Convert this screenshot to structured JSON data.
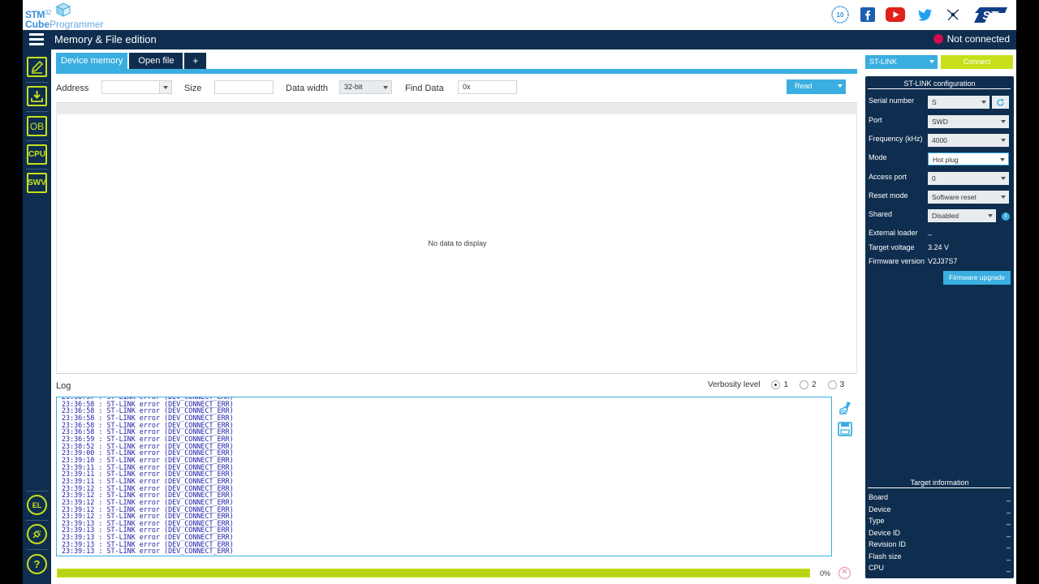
{
  "app": {
    "logo_line1": "STM",
    "logo_line1_sup": "32",
    "logo_line2a": "Cube",
    "logo_line2b": "Programmer"
  },
  "header": {
    "social_icons": [
      "anniversary-badge-icon",
      "facebook-icon",
      "youtube-icon",
      "twitter-icon",
      "network-icon",
      "st-logo-icon"
    ],
    "anniversary_text": "10"
  },
  "titlebar": {
    "title": "Memory & File edition",
    "status": "Not connected",
    "status_color": "#d10b4f"
  },
  "sidebar": {
    "items": [
      {
        "icon": "pencil-edit-icon"
      },
      {
        "icon": "download-icon"
      },
      {
        "icon": "ob-icon",
        "label": "OB"
      },
      {
        "icon": "cpu-icon",
        "label": "CPU"
      },
      {
        "icon": "swv-icon",
        "label": "SWV"
      }
    ],
    "bottom_items": [
      {
        "icon": "el-icon",
        "label": "EL"
      },
      {
        "icon": "plug-icon"
      },
      {
        "icon": "help-icon",
        "label": "?"
      }
    ]
  },
  "tabs": [
    {
      "label": "Device memory",
      "active": true
    },
    {
      "label": "Open file",
      "active": false
    },
    {
      "label": "+",
      "active": false
    }
  ],
  "toolbar": {
    "address_label": "Address",
    "address_value": "",
    "size_label": "Size",
    "size_value": "",
    "data_width_label": "Data width",
    "data_width_value": "32-bit",
    "find_label": "Find Data",
    "find_value": "0x",
    "read_label": "Read"
  },
  "memory": {
    "empty_text": "No data to display"
  },
  "log": {
    "label": "Log",
    "verbosity_label": "Verbosity level",
    "levels": [
      "1",
      "2",
      "3"
    ],
    "selected_level": "1",
    "lines": [
      "23:36:57 : ST-LINK error (DEV_CONNECT_ERR)",
      "23:36:58 : ST-LINK error (DEV_CONNECT_ERR)",
      "23:36:58 : ST-LINK error (DEV_CONNECT_ERR)",
      "23:36:58 : ST-LINK error (DEV_CONNECT_ERR)",
      "23:36:58 : ST-LINK error (DEV_CONNECT_ERR)",
      "23:36:58 : ST-LINK error (DEV_CONNECT_ERR)",
      "23:36:59 : ST-LINK error (DEV_CONNECT_ERR)",
      "23:38:52 : ST-LINK error (DEV_CONNECT_ERR)",
      "23:39:00 : ST-LINK error (DEV_CONNECT_ERR)",
      "23:39:10 : ST-LINK error (DEV_CONNECT_ERR)",
      "23:39:11 : ST-LINK error (DEV_CONNECT_ERR)",
      "23:39:11 : ST-LINK error (DEV_CONNECT_ERR)",
      "23:39:11 : ST-LINK error (DEV_CONNECT_ERR)",
      "23:39:12 : ST-LINK error (DEV_CONNECT_ERR)",
      "23:39:12 : ST-LINK error (DEV_CONNECT_ERR)",
      "23:39:12 : ST-LINK error (DEV_CONNECT_ERR)",
      "23:39:12 : ST-LINK error (DEV_CONNECT_ERR)",
      "23:39:12 : ST-LINK error (DEV_CONNECT_ERR)",
      "23:39:13 : ST-LINK error (DEV_CONNECT_ERR)",
      "23:39:13 : ST-LINK error (DEV_CONNECT_ERR)",
      "23:39:13 : ST-LINK error (DEV_CONNECT_ERR)",
      "23:39:13 : ST-LINK error (DEV_CONNECT_ERR)",
      "23:39:13 : ST-LINK error (DEV_CONNECT_ERR)"
    ]
  },
  "progress": {
    "fraction": 1.0,
    "percent_text": "0%"
  },
  "interface": {
    "selected": "ST-LINK",
    "connect_label": "Connect"
  },
  "config": {
    "title": "ST-LINK configuration",
    "serial_label": "Serial number",
    "serial_value": "S",
    "port_label": "Port",
    "port_value": "SWD",
    "freq_label": "Frequency (kHz)",
    "freq_value": "4000",
    "mode_label": "Mode",
    "mode_value": "Hot plug",
    "access_label": "Access port",
    "access_value": "0",
    "reset_label": "Reset mode",
    "reset_value": "Software reset",
    "shared_label": "Shared",
    "shared_value": "Disabled",
    "loader_label": "External loader",
    "loader_value": "_",
    "voltage_label": "Target voltage",
    "voltage_value": "3.24 V",
    "firmware_label": "Firmware version",
    "firmware_value": "V2J37S7",
    "firmware_upgrade_label": "Firmware upgrade"
  },
  "target": {
    "title": "Target information",
    "rows": [
      {
        "label": "Board",
        "value": "_"
      },
      {
        "label": "Device",
        "value": "_"
      },
      {
        "label": "Type",
        "value": "_"
      },
      {
        "label": "Device ID",
        "value": "_"
      },
      {
        "label": "Revision ID",
        "value": "_"
      },
      {
        "label": "Flash size",
        "value": "_"
      },
      {
        "label": "CPU",
        "value": "_"
      }
    ]
  },
  "colors": {
    "navy": "#0f2e4f",
    "accent_blue": "#3aaee0",
    "accent_green": "#c7e019",
    "log_text": "#1d1fa8"
  }
}
